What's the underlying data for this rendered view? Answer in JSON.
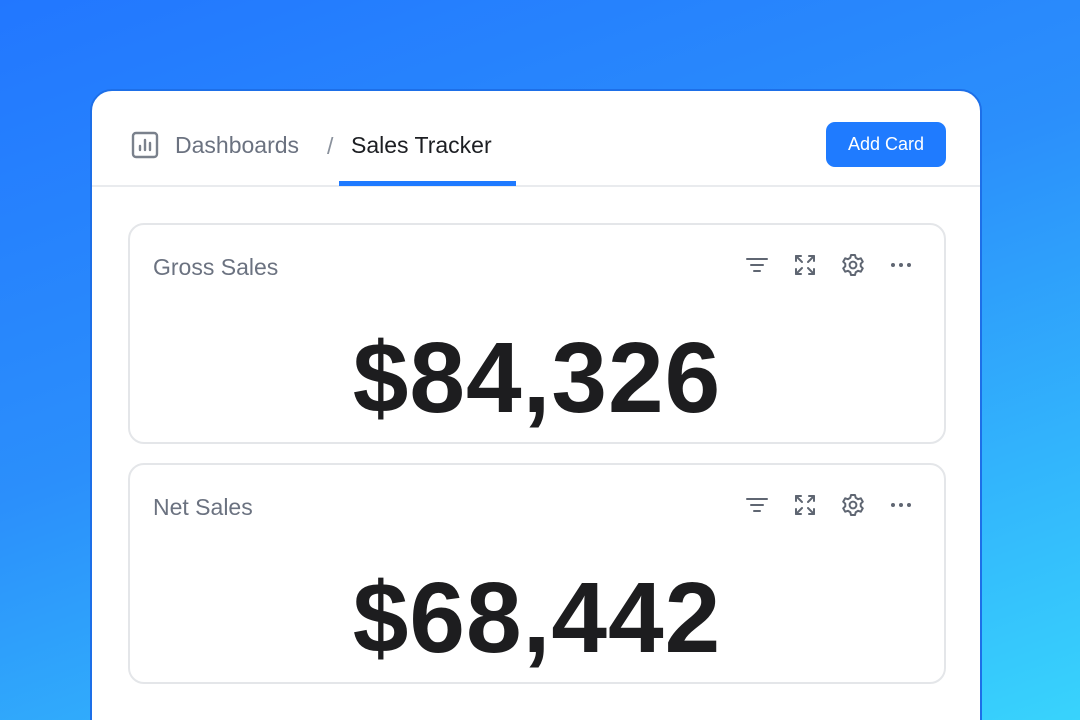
{
  "header": {
    "breadcrumb_parent": "Dashboards",
    "breadcrumb_separator": "/",
    "breadcrumb_current": "Sales Tracker",
    "add_card_label": "Add Card",
    "icon": "dashboard-chart-icon"
  },
  "cards": [
    {
      "title": "Gross Sales",
      "value": "$84,326",
      "tools": [
        "filter-icon",
        "expand-icon",
        "gear-icon",
        "more-icon"
      ]
    },
    {
      "title": "Net Sales",
      "value": "$68,442",
      "tools": [
        "filter-icon",
        "expand-icon",
        "gear-icon",
        "more-icon"
      ]
    }
  ],
  "colors": {
    "accent": "#1f7bff",
    "background_top": "#2277ff",
    "background_bottom": "#38d3fc",
    "value_text": "#1d1d1f",
    "muted_text": "#6b7280"
  }
}
